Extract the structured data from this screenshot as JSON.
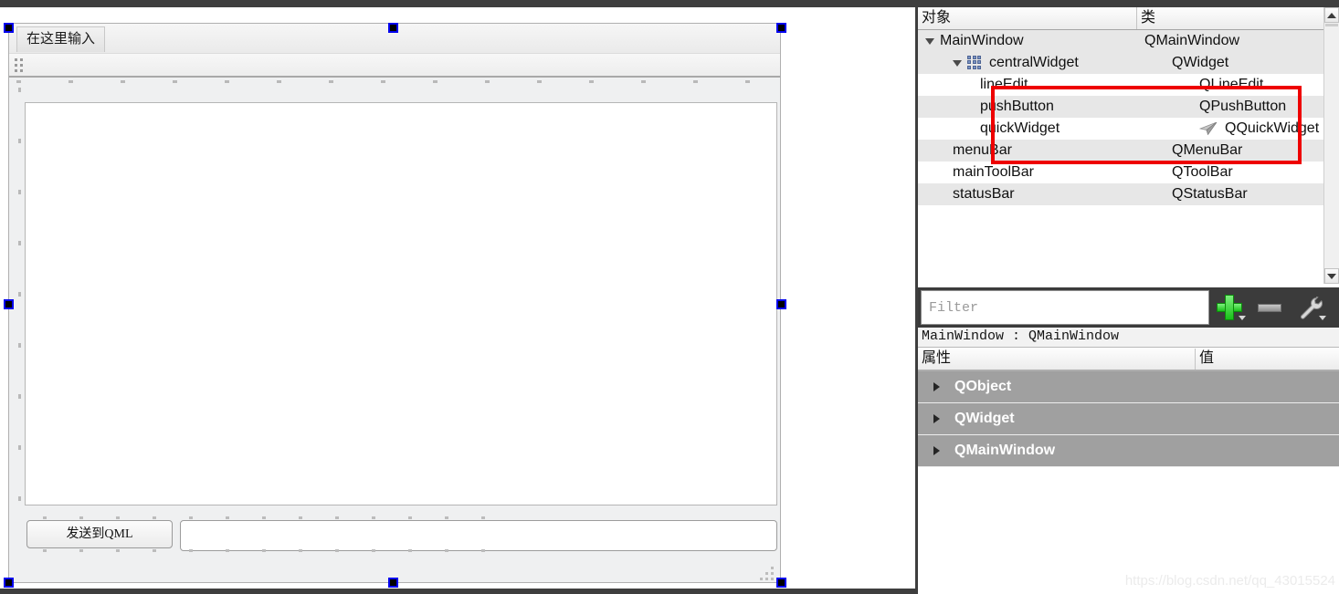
{
  "designer": {
    "menubar": {
      "type_here_label": "在这里输入"
    },
    "form": {
      "push_button_label": "发送到QML",
      "line_edit_value": "",
      "line_edit_placeholder": ""
    }
  },
  "object_inspector": {
    "headers": {
      "object": "对象",
      "class": "类"
    },
    "rows": [
      {
        "name": "MainWindow",
        "class": "QMainWindow",
        "indent": 0,
        "arrow": "open",
        "icon": "none",
        "alt": true
      },
      {
        "name": "centralWidget",
        "class": "QWidget",
        "indent": 1,
        "arrow": "open",
        "icon": "grid-icon",
        "alt": true
      },
      {
        "name": "lineEdit",
        "class": "QLineEdit",
        "indent": 2,
        "arrow": "none",
        "icon": "none",
        "alt": false
      },
      {
        "name": "pushButton",
        "class": "QPushButton",
        "indent": 2,
        "arrow": "none",
        "icon": "none",
        "alt": true
      },
      {
        "name": "quickWidget",
        "class": "QQuickWidget",
        "indent": 2,
        "arrow": "none",
        "icon": "plane-icon",
        "alt": false
      },
      {
        "name": "menuBar",
        "class": "QMenuBar",
        "indent": 1,
        "arrow": "none",
        "icon": "none",
        "alt": true
      },
      {
        "name": "mainToolBar",
        "class": "QToolBar",
        "indent": 1,
        "arrow": "none",
        "icon": "none",
        "alt": false
      },
      {
        "name": "statusBar",
        "class": "QStatusBar",
        "indent": 1,
        "arrow": "none",
        "icon": "none",
        "alt": true
      }
    ],
    "annotation_color": "#ee0000"
  },
  "filter_bar": {
    "placeholder": "Filter",
    "value": "",
    "add_icon": "plus-icon",
    "remove_icon": "minus-icon",
    "configure_icon": "wrench-icon"
  },
  "selected_object": "MainWindow : QMainWindow",
  "property_editor": {
    "headers": {
      "attribute": "属性",
      "value": "值"
    },
    "groups": [
      {
        "label": "QObject"
      },
      {
        "label": "QWidget"
      },
      {
        "label": "QMainWindow"
      }
    ]
  },
  "watermark": "https://blog.csdn.net/qq_43015524"
}
